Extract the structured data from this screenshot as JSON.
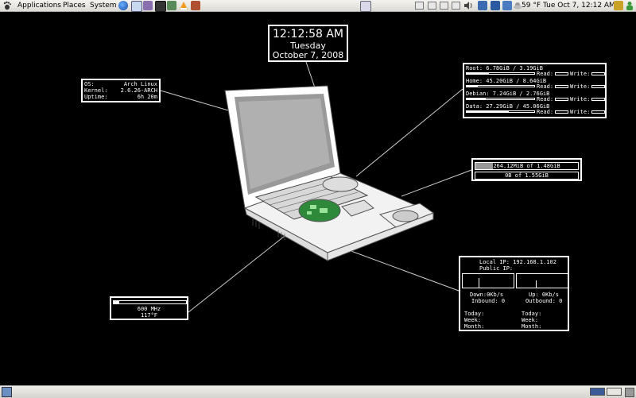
{
  "top_panel": {
    "menus": [
      "Applications",
      "Places",
      "System"
    ],
    "temperature": "59 °F",
    "datetime": "Tue Oct  7, 12:12 AM"
  },
  "clock": {
    "time": "12:12:58 AM",
    "day": "Tuesday",
    "date": "October  7, 2008"
  },
  "sysinfo": {
    "rows": [
      {
        "label": "OS:",
        "value": "Arch Linux"
      },
      {
        "label": "Kernel:",
        "value": "2.6.26-ARCH"
      },
      {
        "label": "Uptime:",
        "value": "6h 20m"
      }
    ]
  },
  "disks": {
    "read_label": "Read:",
    "write_label": "Write:",
    "items": [
      {
        "text": "Root:   6.78GiB / 3.19GiB",
        "usage": 0.33
      },
      {
        "text": "Home:  45.20GiB / 8.64GiB",
        "usage": 0.16
      },
      {
        "text": "Debian: 7.24GiB / 2.76GiB",
        "usage": 0.28
      },
      {
        "text": "Data:  27.29GiB / 45.06GiB",
        "usage": 0.62
      }
    ]
  },
  "memory": {
    "ram_text": "264.12MiB of 1.48GiB",
    "ram_usage": 0.17,
    "swap_text": "0B of 1.55GiB",
    "swap_usage": 0.0
  },
  "cpu": {
    "freq": "600 MHz",
    "temp": "117°F",
    "usage": 0.08
  },
  "network": {
    "local_ip": "Local IP: 192.168.1.102",
    "public_ip": "Public IP:",
    "down": "Down:0Kb/s",
    "inbound": "Inbound: 0",
    "up": "Up: 0Kb/s",
    "outbound": "Outbound: 0",
    "today": "Today:",
    "week": "Week:",
    "month": "Month:"
  }
}
